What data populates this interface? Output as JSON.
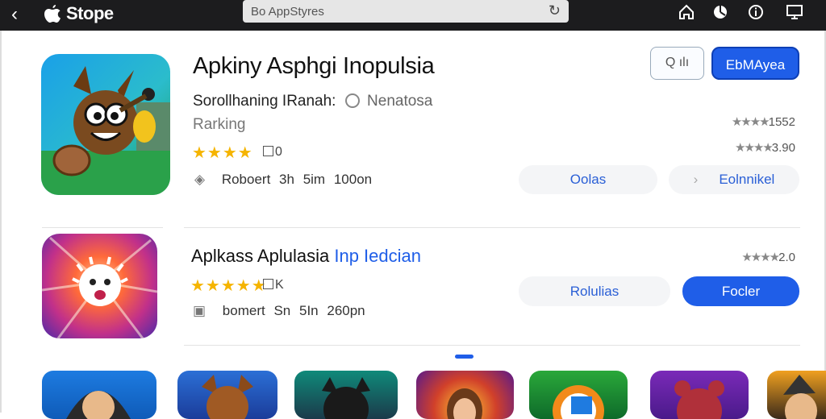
{
  "topbar": {
    "back_glyph": "‹",
    "store_label": "Stope",
    "address": "Bo AppStyres",
    "icons": [
      "home-icon",
      "pie-chart-icon",
      "info-icon",
      "screen-icon"
    ]
  },
  "apps": [
    {
      "title": "Apkiny Asphgi Inopulsia",
      "subtitle": "Sorollhaning IRanah:",
      "subtitle_secondary": "Nenatosa",
      "ranking": "Rarking",
      "stars": "★★★★",
      "rating_count": "0",
      "meta": [
        "Roboert",
        "3h",
        "5im",
        "100on"
      ],
      "right_ratings": [
        "1552",
        "3.90"
      ],
      "secondary_button": "Oolas",
      "tertiary_button": "Eolnnikel"
    },
    {
      "title": "Aplkass Aplulasia",
      "title_highlight": "Inp Iedcian",
      "stars": "★★★★★",
      "rating_count": "K",
      "meta": [
        "bomert",
        "Sn",
        "5In",
        "260pn"
      ],
      "right_ratings": [
        "2.0"
      ],
      "secondary_button": "Rolulias",
      "primary_button": "Focler"
    }
  ],
  "header_actions": {
    "search_label": "Q ılı",
    "primary_label": "EbMAyea"
  },
  "colors": {
    "accent": "#1f5ee8",
    "star": "#f5b400",
    "topbar": "#1c1c1e"
  }
}
